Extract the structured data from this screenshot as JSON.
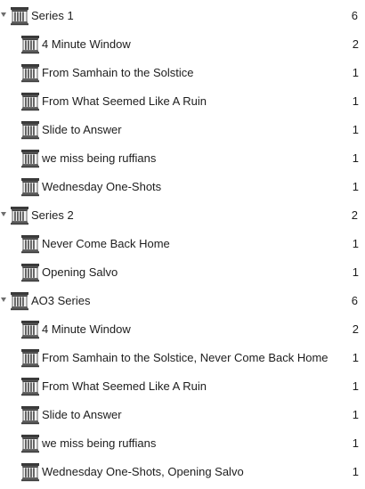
{
  "tree": [
    {
      "label": "Series 1",
      "count": "6",
      "icon": "column-icon",
      "children": [
        {
          "label": "4 Minute Window",
          "count": "2",
          "icon": "column-icon"
        },
        {
          "label": "From Samhain to the Solstice",
          "count": "1",
          "icon": "column-icon"
        },
        {
          "label": "From What Seemed Like A Ruin",
          "count": "1",
          "icon": "column-icon"
        },
        {
          "label": "Slide to Answer",
          "count": "1",
          "icon": "column-icon"
        },
        {
          "label": "we miss being ruffians",
          "count": "1",
          "icon": "column-icon"
        },
        {
          "label": "Wednesday One-Shots",
          "count": "1",
          "icon": "column-icon"
        }
      ]
    },
    {
      "label": "Series 2",
      "count": "2",
      "icon": "column-icon",
      "children": [
        {
          "label": "Never Come Back Home",
          "count": "1",
          "icon": "column-icon"
        },
        {
          "label": "Opening Salvo",
          "count": "1",
          "icon": "column-icon"
        }
      ]
    },
    {
      "label": "AO3 Series",
      "count": "6",
      "icon": "column-icon",
      "children": [
        {
          "label": "4 Minute Window",
          "count": "2",
          "icon": "column-icon"
        },
        {
          "label": "From Samhain to the Solstice, Never Come Back Home",
          "count": "1",
          "icon": "column-icon"
        },
        {
          "label": "From What Seemed Like A Ruin",
          "count": "1",
          "icon": "column-icon"
        },
        {
          "label": "Slide to Answer",
          "count": "1",
          "icon": "column-icon"
        },
        {
          "label": "we miss being ruffians",
          "count": "1",
          "icon": "column-icon"
        },
        {
          "label": "Wednesday One-Shots, Opening Salvo",
          "count": "1",
          "icon": "column-icon"
        }
      ]
    }
  ],
  "colors": {
    "text": "#1d1d1d",
    "disclosure": "#6e6e6e",
    "icon_dark": "#3a3a3a",
    "icon_light": "#f4f4f4"
  }
}
